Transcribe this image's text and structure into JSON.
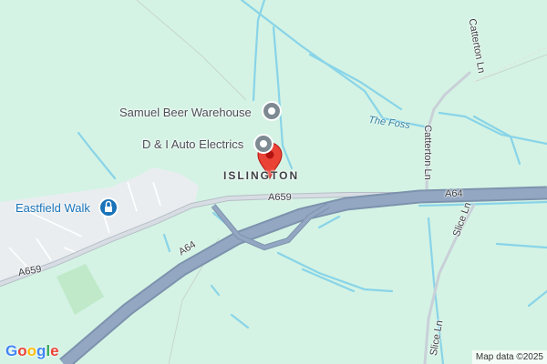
{
  "map": {
    "place_label": "ISLINGTON",
    "pois": [
      {
        "name": "Samuel Beer Warehouse",
        "icon": "grey-poi-pin-icon"
      },
      {
        "name": "D & I Auto Electrics",
        "icon": "grey-poi-pin-icon"
      },
      {
        "name": "Eastfield Walk",
        "icon": "blue-lock-poi-icon"
      }
    ],
    "roads": {
      "a659_upper": "A659",
      "a659_lower": "A659",
      "a64_left": "A64",
      "a64_right": "A64",
      "catterton_upper": "Catterton Ln",
      "catterton_lower": "Catterton Ln",
      "slice_upper": "Slice Ln",
      "slice_lower": "Slice Ln"
    },
    "waterway": "The Foss",
    "marker_icon": "red-location-pin-icon",
    "logo": "Google",
    "attribution": "Map data ©2025",
    "colors": {
      "land": "#d4f3e4",
      "urban": "#e9edf0",
      "park": "#bfe9c9",
      "water": "#89d4e8",
      "motorway": "#8ea3bf",
      "road": "#c9d0d8",
      "marker": "#ea4335"
    }
  }
}
